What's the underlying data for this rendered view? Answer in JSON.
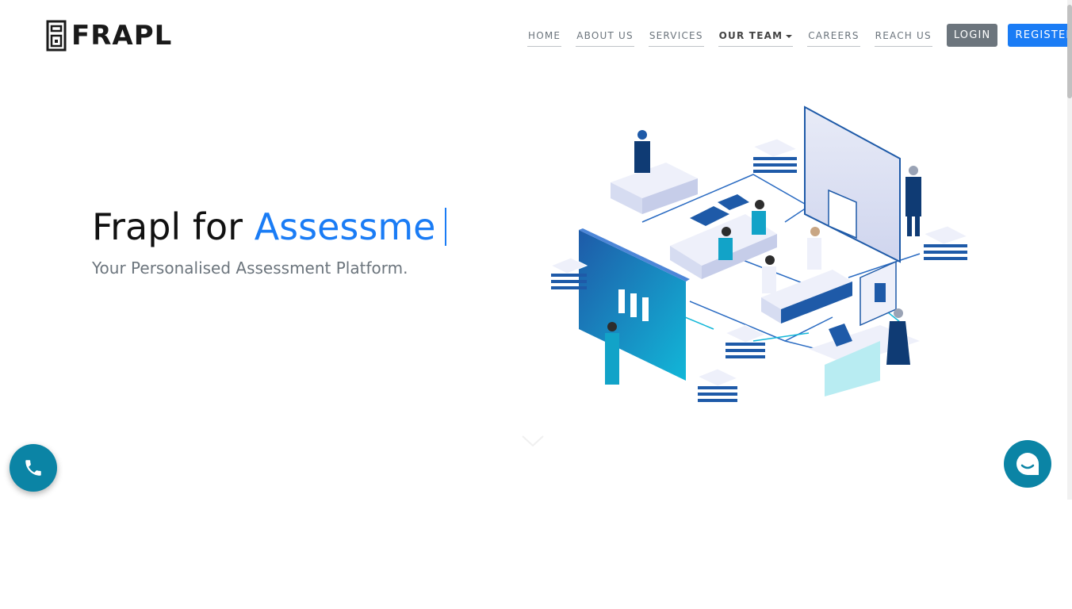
{
  "brand": {
    "name": "FRAPL"
  },
  "nav": {
    "items": [
      {
        "label": "HOME"
      },
      {
        "label": "ABOUT US"
      },
      {
        "label": "SERVICES"
      },
      {
        "label": "OUR TEAM"
      },
      {
        "label": "CAREERS"
      },
      {
        "label": "REACH US"
      }
    ],
    "login_label": "LOGIN",
    "register_label": "REGISTER"
  },
  "hero": {
    "title_prefix": "Frapl for",
    "title_typed": "Assessme",
    "subtitle": "Your Personalised Assessment Platform."
  },
  "colors": {
    "accent": "#1a7cf5",
    "login_button": "#6c757d",
    "floating_buttons": "#0b84a5"
  },
  "icons": {
    "call": "phone-icon",
    "chat": "chat-bubble-icon",
    "scroll": "chevron-down-icon"
  }
}
